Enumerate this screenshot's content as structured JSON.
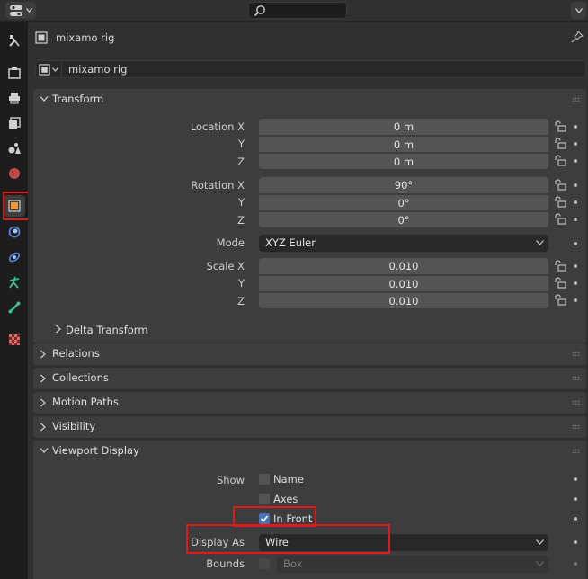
{
  "header": {
    "editor_type_icon": "properties-editor-icon",
    "search_placeholder": ""
  },
  "tabs": [
    {
      "name": "tool",
      "icon": "wrench-screwdriver-icon"
    },
    {
      "name": "render",
      "icon": "camera-back-icon"
    },
    {
      "name": "output",
      "icon": "printer-icon"
    },
    {
      "name": "view-layer",
      "icon": "image-stack-icon"
    },
    {
      "name": "scene",
      "icon": "scene-icon"
    },
    {
      "name": "world",
      "icon": "globe-icon"
    },
    {
      "name": "object",
      "icon": "object-square-icon",
      "active": true
    },
    {
      "name": "modifiers",
      "icon": "blue-dot-icon"
    },
    {
      "name": "particles",
      "icon": "orbit-icon"
    },
    {
      "name": "physics",
      "icon": "armature-figure-icon"
    },
    {
      "name": "object-data",
      "icon": "bone-icon"
    },
    {
      "name": "texture",
      "icon": "checker-icon"
    }
  ],
  "context": {
    "object_name": "mixamo rig"
  },
  "name_field": {
    "value": "mixamo rig"
  },
  "transform": {
    "title": "Transform",
    "location": {
      "labels": [
        "Location X",
        "Y",
        "Z"
      ],
      "values": [
        "0 m",
        "0 m",
        "0 m"
      ]
    },
    "rotation": {
      "labels": [
        "Rotation X",
        "Y",
        "Z"
      ],
      "values": [
        "90°",
        "0°",
        "0°"
      ]
    },
    "mode": {
      "label": "Mode",
      "value": "XYZ Euler"
    },
    "scale": {
      "labels": [
        "Scale X",
        "Y",
        "Z"
      ],
      "values": [
        "0.010",
        "0.010",
        "0.010"
      ]
    },
    "delta": "Delta Transform"
  },
  "panels": {
    "relations": "Relations",
    "collections": "Collections",
    "motion_paths": "Motion Paths",
    "visibility": "Visibility",
    "viewport_display": "Viewport Display"
  },
  "viewport_display": {
    "show_label": "Show",
    "name": {
      "label": "Name",
      "checked": false
    },
    "axes": {
      "label": "Axes",
      "checked": false
    },
    "in_front": {
      "label": "In Front",
      "checked": true
    },
    "display_as": {
      "label": "Display As",
      "value": "Wire"
    },
    "bounds": {
      "label": "Bounds",
      "checked": false,
      "value": "Box"
    }
  },
  "colors": {
    "accent": "#4772b3",
    "highlight": "#e01a1a",
    "object_orange": "#f09a3a"
  }
}
